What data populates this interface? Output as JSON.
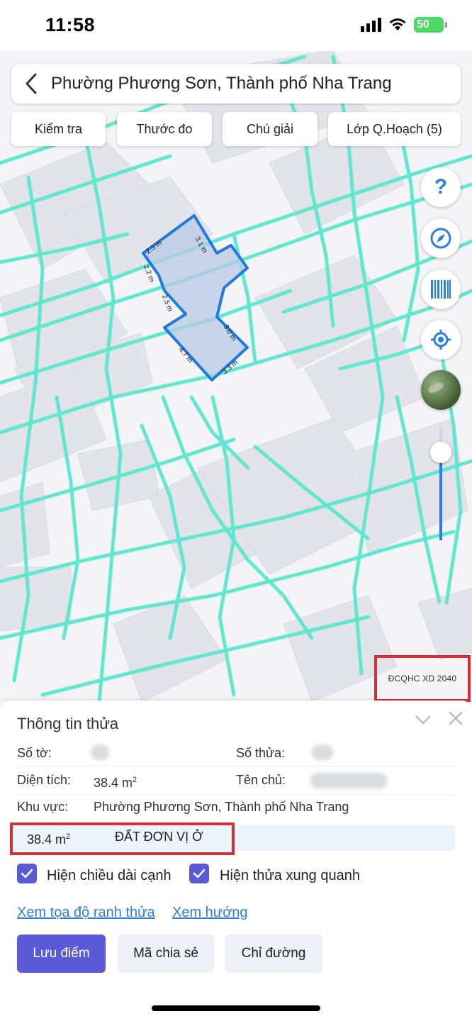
{
  "status_bar": {
    "time": "11:58",
    "battery": "50"
  },
  "header": {
    "title": "Phường Phương Sơn, Thành phố Nha Trang"
  },
  "tabs": [
    {
      "label": "Kiểm tra"
    },
    {
      "label": "Thước đo"
    },
    {
      "label": "Chú giải"
    },
    {
      "label": "Lớp Q.Hoạch (5)"
    }
  ],
  "map_controls": {
    "help_label": "?",
    "zoom_level": 0.8,
    "icons": [
      "help-icon",
      "compass-icon",
      "barcode-icon",
      "locate-icon",
      "satellite-layer-icon"
    ]
  },
  "parcel_edges": [
    "3.1 m",
    "2.3 m",
    "2.2 m",
    "2.5 m",
    "3.0 m",
    "4.7 m",
    "3.3 m"
  ],
  "plan_label": "ĐCQHC XD 2040",
  "sheet": {
    "title": "Thông tin thửa",
    "so_to_label": "Số tờ:",
    "so_thua_label": "Số thửa:",
    "dien_tich_label": "Diện tích:",
    "dien_tich_value": "38.4 m",
    "ten_chu_label": "Tên chủ:",
    "khu_vuc_label": "Khu vực:",
    "khu_vuc_value": "Phường Phương Sơn, Thành phố Nha Trang",
    "zone_area": "38.4 m",
    "zone_name": "ĐẤT ĐƠN VỊ Ở",
    "area_unit_exponent": "2"
  },
  "options": {
    "show_edge_lengths": "Hiện chiều dài cạnh",
    "show_neighbors": "Hiện thửa xung quanh"
  },
  "links": {
    "coordinates": "Xem tọa độ ranh thửa",
    "direction": "Xem hướng"
  },
  "actions": {
    "save": "Lưu điểm",
    "share": "Mã chia sẻ",
    "route": "Chỉ đường"
  },
  "colors": {
    "accent": "#5b5ad6",
    "map_lines": "#5fe6cf",
    "parcel_outline": "#1f7ae0",
    "highlight_box": "#d3313a",
    "link": "#2f7fd6"
  }
}
